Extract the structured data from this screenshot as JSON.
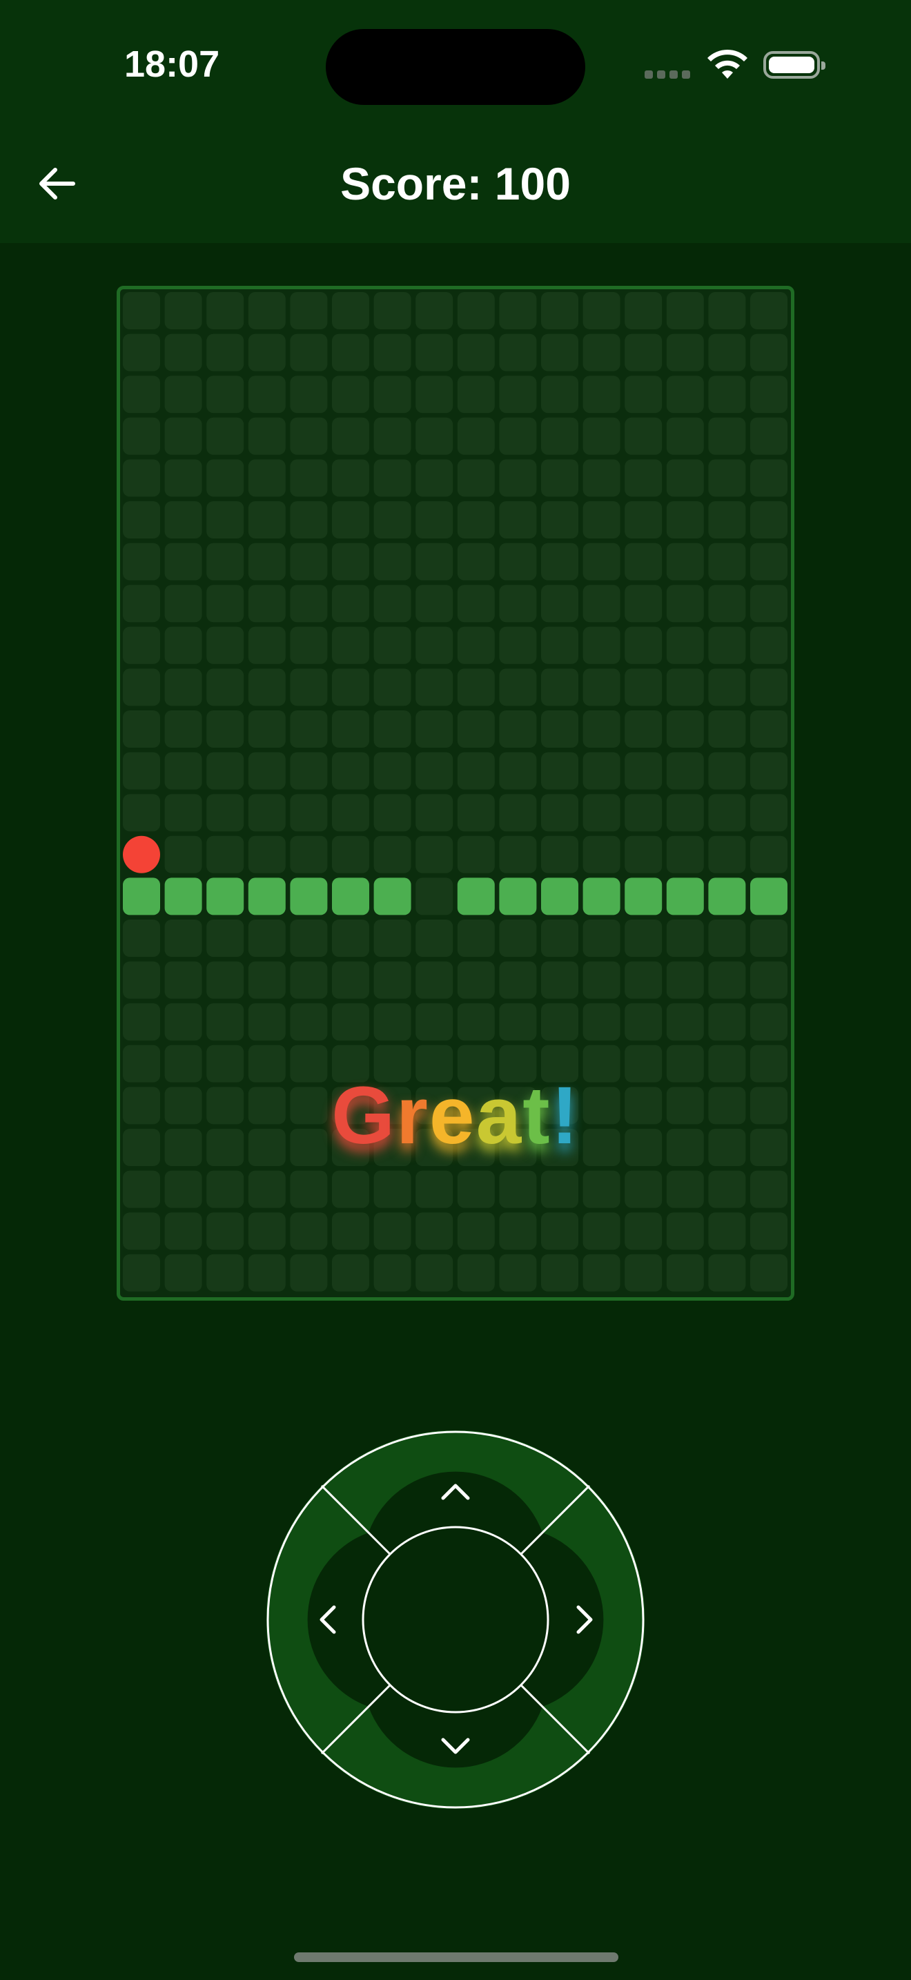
{
  "status_bar": {
    "time": "18:07"
  },
  "header": {
    "score_label": "Score: 100",
    "back_icon": "arrow-left-icon"
  },
  "board": {
    "columns": 16,
    "rows": 24,
    "food": {
      "col": 0,
      "row": 13
    },
    "snake_cells": [
      {
        "col": 0,
        "row": 14
      },
      {
        "col": 1,
        "row": 14
      },
      {
        "col": 2,
        "row": 14
      },
      {
        "col": 3,
        "row": 14
      },
      {
        "col": 4,
        "row": 14
      },
      {
        "col": 5,
        "row": 14
      },
      {
        "col": 6,
        "row": 14
      },
      {
        "col": 8,
        "row": 14
      },
      {
        "col": 9,
        "row": 14
      },
      {
        "col": 10,
        "row": 14
      },
      {
        "col": 11,
        "row": 14
      },
      {
        "col": 12,
        "row": 14
      },
      {
        "col": 13,
        "row": 14
      },
      {
        "col": 14,
        "row": 14
      },
      {
        "col": 15,
        "row": 14
      }
    ],
    "colors": {
      "empty_cell": "#173a18",
      "snake": "#4caf50",
      "food": "#f44336",
      "border": "#1f6b24"
    }
  },
  "message": {
    "text": "Great!",
    "letter_colors": [
      "#e94b3c",
      "#f07a2e",
      "#f5b52a",
      "#c9c832",
      "#6cbf48",
      "#2fa8c6",
      "#8a3fd1"
    ]
  },
  "dpad": {
    "up_icon": "chevron-up-icon",
    "down_icon": "chevron-down-icon",
    "left_icon": "chevron-left-icon",
    "right_icon": "chevron-right-icon",
    "ring_color": "#0f4d12",
    "center_color": "#052806"
  }
}
